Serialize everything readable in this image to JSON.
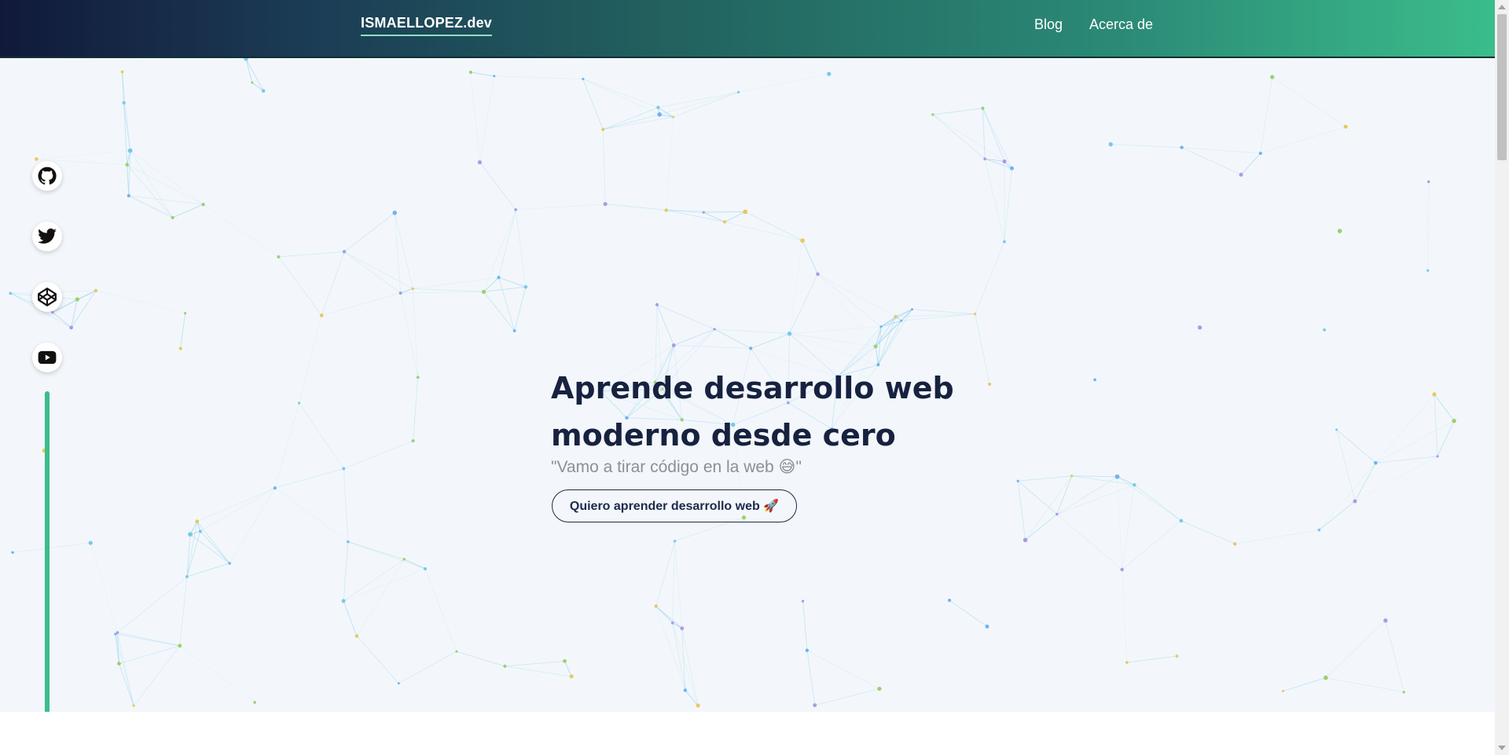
{
  "navbar": {
    "brand": "ISMAELLOPEZ.dev",
    "links": [
      {
        "label": "Blog"
      },
      {
        "label": "Acerca de"
      }
    ]
  },
  "social_links": [
    {
      "icon": "github-icon"
    },
    {
      "icon": "twitter-icon"
    },
    {
      "icon": "codepen-icon"
    },
    {
      "icon": "youtube-icon"
    }
  ],
  "hero": {
    "title_line1": "Aprende desarrollo web",
    "title_line2": "moderno desde cero",
    "quote": "\"Vamo a tirar código en la web 😅\"",
    "cta_label": "Quiero aprender desarrollo web 🚀"
  },
  "colors": {
    "nav_start": "#11193a",
    "nav_end": "#3bbd8b",
    "accent_green": "#3bbd8b",
    "hero_bg": "#f3f7fb",
    "title": "#172240"
  }
}
